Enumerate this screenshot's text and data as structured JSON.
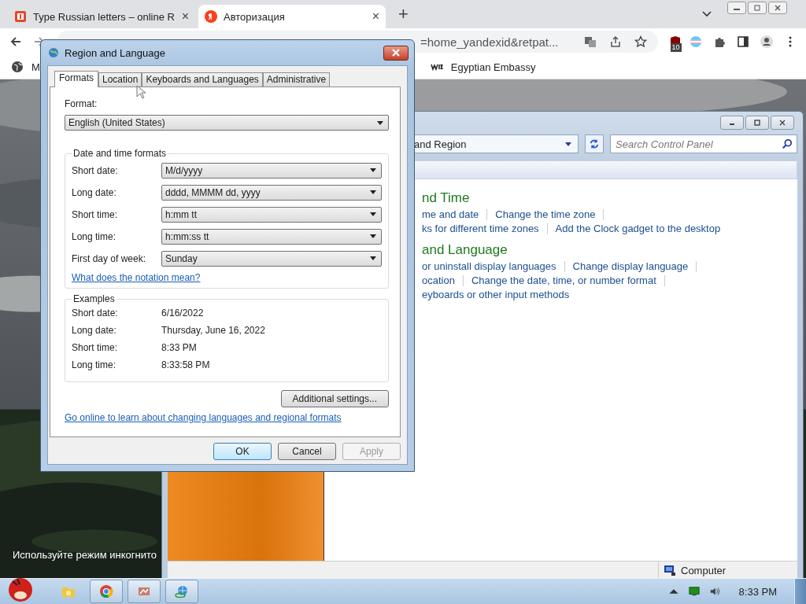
{
  "browser": {
    "tabs": [
      {
        "title": "Type Russian letters – online R",
        "selected": false,
        "close": "×"
      },
      {
        "title": "Авторизация",
        "selected": true,
        "close": "×"
      }
    ],
    "new_tab": "+",
    "address": "=home_yandexid&retpat...",
    "extension_badge": "10",
    "bookmarks": [
      {
        "label": "M",
        "kind": "globe"
      },
      {
        "label": "Egyptian Embassy",
        "kind": "wix"
      }
    ]
  },
  "page_caption": "Используйте режим инкогнито",
  "dialog": {
    "title": "Region and Language",
    "tabs": [
      {
        "label": "Formats",
        "selected": true
      },
      {
        "label": "Location",
        "selected": false
      },
      {
        "label": "Keyboards and Languages",
        "selected": false
      },
      {
        "label": "Administrative",
        "selected": false
      }
    ],
    "format_label": "Format:",
    "format_value": "English (United States)",
    "formats_group": "Date and time formats",
    "formats": [
      {
        "label": "Short date:",
        "value": "M/d/yyyy"
      },
      {
        "label": "Long date:",
        "value": "dddd, MMMM dd, yyyy"
      },
      {
        "label": "Short time:",
        "value": "h:mm tt"
      },
      {
        "label": "Long time:",
        "value": "h:mm:ss tt"
      },
      {
        "label": "First day of week:",
        "value": "Sunday"
      }
    ],
    "notation_link": "What does the notation mean?",
    "examples_group": "Examples",
    "examples": [
      {
        "label": "Short date:",
        "value": "6/16/2022"
      },
      {
        "label": "Long date:",
        "value": "Thursday, June 16, 2022"
      },
      {
        "label": "Short time:",
        "value": "8:33 PM"
      },
      {
        "label": "Long time:",
        "value": "8:33:58 PM"
      }
    ],
    "additional_button": "Additional settings...",
    "online_link": "Go online to learn about changing languages and regional formats",
    "buttons": [
      {
        "label": "OK",
        "default": true,
        "disabled": false
      },
      {
        "label": "Cancel",
        "default": false,
        "disabled": false
      },
      {
        "label": "Apply",
        "default": false,
        "disabled": true
      }
    ]
  },
  "control_panel": {
    "breadcrumb": "and Region",
    "search_placeholder": "Search Control Panel",
    "sections": [
      {
        "heading": "nd Time",
        "lines": [
          {
            "links": [
              "me and date",
              "Change the time zone"
            ],
            "trailing_separator": true
          },
          {
            "links": [
              "ks for different time zones",
              "Add the Clock gadget to the desktop"
            ],
            "trailing_separator": false
          }
        ]
      },
      {
        "heading": "and Language",
        "lines": [
          {
            "links": [
              "or uninstall display languages",
              "Change display language"
            ],
            "trailing_separator": true
          },
          {
            "links": [
              "ocation",
              "Change the date, time, or number format"
            ],
            "trailing_separator": true
          },
          {
            "links": [
              "eyboards or other input methods"
            ],
            "trailing_separator": false
          }
        ]
      }
    ],
    "status": "Computer"
  },
  "taskbar": {
    "clock": "8:33 PM"
  }
}
